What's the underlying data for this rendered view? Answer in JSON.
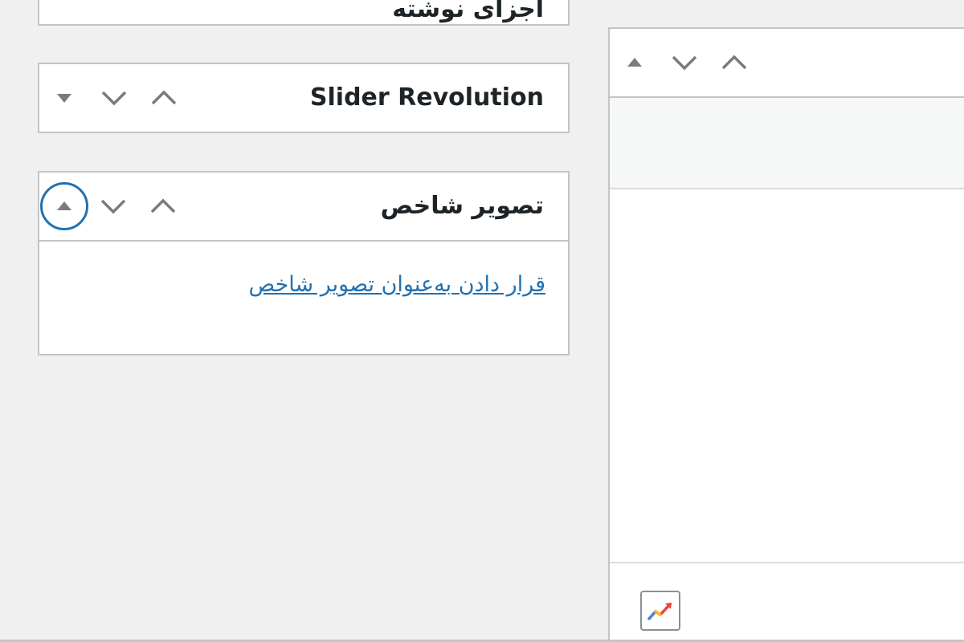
{
  "boxes": {
    "top_partial": {
      "title": "اجزای نوشته"
    },
    "slider": {
      "title": "Slider Revolution"
    },
    "featured_image": {
      "title": "تصویر شاخص",
      "set_link": "قرار دادن به‌عنوان تصویر شاخص"
    }
  },
  "icons": {
    "move_down": "toggle-arrow-down-icon",
    "lower": "chevron-down-icon",
    "higher": "chevron-up-icon",
    "toggle_up": "toggle-arrow-up-icon",
    "trend": "trend-chart-icon"
  },
  "colors": {
    "accent": "#2271b1",
    "border": "#c3c4c7",
    "icon_gray": "#787c82",
    "text": "#1d2327"
  }
}
